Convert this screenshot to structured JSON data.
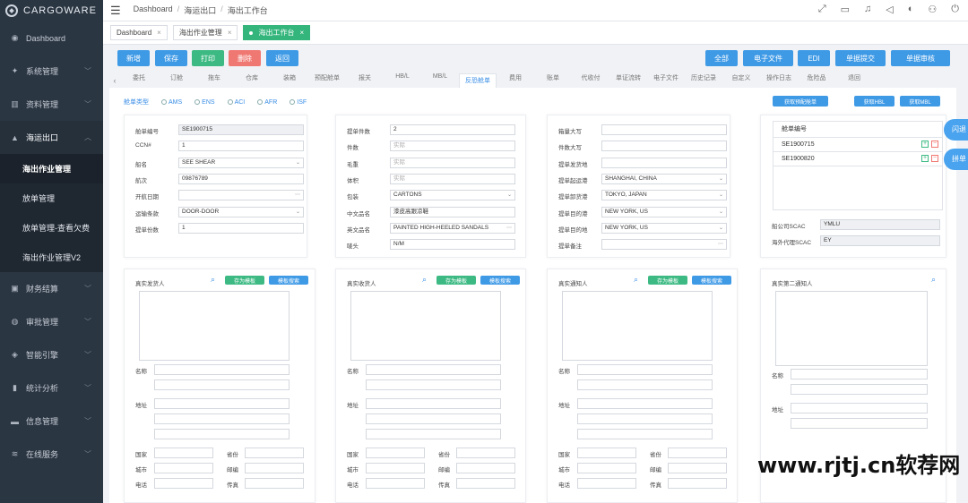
{
  "app": {
    "brand": "CARGOWARE"
  },
  "sidebar": {
    "items": [
      {
        "icon": "dashboard-icon",
        "glyph": "◉",
        "label": "Dashboard"
      },
      {
        "icon": "settings-icon",
        "glyph": "✦",
        "label": "系统管理"
      },
      {
        "icon": "data-icon",
        "glyph": "▥",
        "label": "资料管理"
      },
      {
        "icon": "ship-icon",
        "glyph": "▲",
        "label": "海运出口"
      },
      {
        "icon": "finance-icon",
        "glyph": "▣",
        "label": "财务结算"
      },
      {
        "icon": "audit-icon",
        "glyph": "◍",
        "label": "审批管理"
      },
      {
        "icon": "engine-icon",
        "glyph": "◈",
        "label": "智能引擎"
      },
      {
        "icon": "stats-icon",
        "glyph": "▮",
        "label": "统计分析"
      },
      {
        "icon": "message-icon",
        "glyph": "▬",
        "label": "信息管理"
      },
      {
        "icon": "service-icon",
        "glyph": "≋",
        "label": "在线服务"
      }
    ],
    "subitems": [
      "海出作业管理",
      "放单管理",
      "放单管理-查看欠费",
      "海出作业管理V2"
    ]
  },
  "topbar": {
    "breadcrumb": [
      "Dashboard",
      "海运出口",
      "海出工作台"
    ],
    "icons": [
      "expand-icon",
      "chat-icon",
      "bell-icon",
      "volume-icon",
      "skin-icon",
      "user-icon",
      "power-icon"
    ]
  },
  "pagetabs": [
    {
      "label": "Dashboard"
    },
    {
      "label": "海出作业管理"
    },
    {
      "label": "海出工作台"
    }
  ],
  "actions": {
    "left": [
      "新增",
      "保存",
      "打印",
      "删除",
      "返回"
    ],
    "right": [
      "全部",
      "电子文件",
      "EDI",
      "单据提交",
      "单据审核"
    ]
  },
  "moduletabs": [
    "委托",
    "订舱",
    "拖车",
    "仓库",
    "装箱",
    "预配舱单",
    "报关",
    "HB/L",
    "MB/L",
    "反恐舱单",
    "费用",
    "账单",
    "代收付",
    "单证流转",
    "电子文件",
    "历史记录",
    "自定义",
    "操作日志",
    "危险品",
    "退回"
  ],
  "manifest": {
    "type_label": "舱单类型",
    "types": [
      "AMS",
      "ENS",
      "ACI",
      "AFR",
      "ISF"
    ],
    "buttons": [
      "获取预配舱单",
      "获取HBL",
      "获取MBL"
    ]
  },
  "card1": {
    "fields": [
      {
        "label": "舱单编号",
        "value": "SE1900715"
      },
      {
        "label": "CCN#",
        "value": "1"
      },
      {
        "label": "船名",
        "value": "SEE SHEAR"
      },
      {
        "label": "航次",
        "value": "09876789"
      },
      {
        "label": "开航日期",
        "value": ""
      },
      {
        "label": "运输条款",
        "value": "DOOR-DOOR"
      },
      {
        "label": "提单份数",
        "value": "1"
      }
    ]
  },
  "card2": {
    "fields": [
      {
        "label": "提单件数",
        "value": "2"
      },
      {
        "label": "件数",
        "value": "实际"
      },
      {
        "label": "毛重",
        "value": "实际"
      },
      {
        "label": "体积",
        "value": "实际"
      },
      {
        "label": "包装",
        "value": "CARTONS"
      },
      {
        "label": "中文品名",
        "value": "漆皮高跟凉鞋"
      },
      {
        "label": "英文品名",
        "value": "PAINTED HIGH-HEELED SANDALS"
      },
      {
        "label": "唛头",
        "value": "N/M"
      }
    ]
  },
  "card3": {
    "fields": [
      {
        "label": "箱量大写",
        "value": ""
      },
      {
        "label": "件数大写",
        "value": ""
      },
      {
        "label": "提单发货地",
        "value": ""
      },
      {
        "label": "提单起运港",
        "value": "SHANGHAI, CHINA"
      },
      {
        "label": "提单卸货港",
        "value": "TOKYO, JAPAN"
      },
      {
        "label": "提单目的港",
        "value": "NEW YORK, US"
      },
      {
        "label": "提单目的地",
        "value": "NEW YORK, US"
      },
      {
        "label": "提单备注",
        "value": ""
      }
    ]
  },
  "card4": {
    "header": "舱单编号",
    "rows": [
      "SE1900715",
      "SE1900820"
    ],
    "scac_label": "船公司SCAC",
    "scac_value": "YMLU",
    "agent_label": "海外代理SCAC",
    "agent_value": "EY"
  },
  "parties": [
    {
      "title": "真实发货人",
      "btn1": "存为模板",
      "btn2": "模板搜索"
    },
    {
      "title": "真实收货人",
      "btn1": "存为模板",
      "btn2": "模板搜索"
    },
    {
      "title": "真实通知人",
      "btn1": "存为模板",
      "btn2": "模板搜索"
    },
    {
      "title": "真实第二通知人"
    }
  ],
  "party_labels": {
    "name": "名称",
    "addr": "地址",
    "country": "国家",
    "province": "省份",
    "city": "城市",
    "zip": "邮编",
    "phone": "电话",
    "fax": "传真"
  },
  "side_buttons": [
    "闪退",
    "拼单"
  ],
  "watermark": "www.rjtj.cn软荐网"
}
